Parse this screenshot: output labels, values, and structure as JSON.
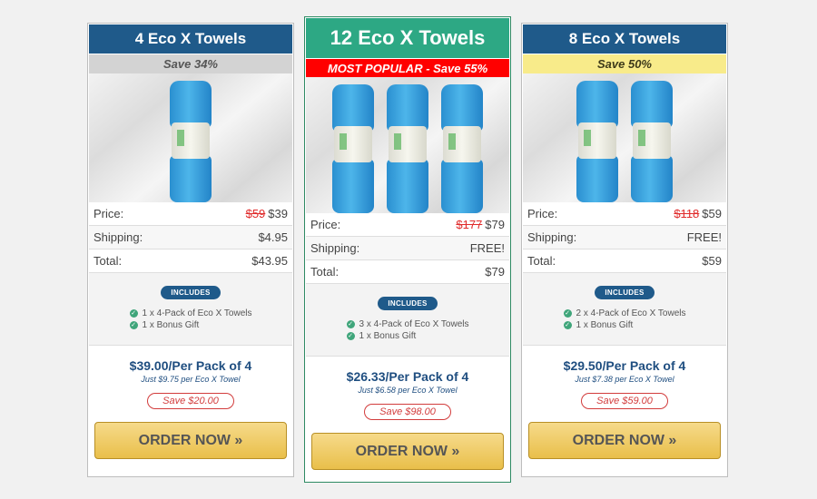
{
  "cards": [
    {
      "title": "4 Eco X Towels",
      "subtitle": "Save 34%",
      "towel_count": 1,
      "price_label": "Price:",
      "old_price": "$59",
      "new_price": "$39",
      "shipping_label": "Shipping:",
      "shipping_value": "$4.95",
      "total_label": "Total:",
      "total_value": "$43.95",
      "includes_label": "INCLUDES",
      "includes": [
        "1 x 4-Pack of Eco X Towels",
        "1 x Bonus Gift"
      ],
      "per_pack": "$39.00/Per Pack of 4",
      "per_towel": "Just $9.75 per Eco X Towel",
      "save_amount": "Save $20.00",
      "order_label": "ORDER NOW »"
    },
    {
      "title": "12 Eco X Towels",
      "subtitle": "MOST POPULAR - Save 55%",
      "towel_count": 3,
      "price_label": "Price:",
      "old_price": "$177",
      "new_price": "$79",
      "shipping_label": "Shipping:",
      "shipping_value": "FREE!",
      "total_label": "Total:",
      "total_value": "$79",
      "includes_label": "INCLUDES",
      "includes": [
        "3 x 4-Pack of Eco X Towels",
        "1 x Bonus Gift"
      ],
      "per_pack": "$26.33/Per Pack of 4",
      "per_towel": "Just $6.58 per Eco X Towel",
      "save_amount": "Save $98.00",
      "order_label": "ORDER NOW »"
    },
    {
      "title": "8 Eco X Towels",
      "subtitle": "Save 50%",
      "towel_count": 2,
      "price_label": "Price:",
      "old_price": "$118",
      "new_price": "$59",
      "shipping_label": "Shipping:",
      "shipping_value": "FREE!",
      "total_label": "Total:",
      "total_value": "$59",
      "includes_label": "INCLUDES",
      "includes": [
        "2 x 4-Pack of Eco X Towels",
        "1 x Bonus Gift"
      ],
      "per_pack": "$29.50/Per Pack of 4",
      "per_towel": "Just $7.38 per Eco X Towel",
      "save_amount": "Save $59.00",
      "order_label": "ORDER NOW »"
    }
  ],
  "icons": {
    "check": "check-circle-icon",
    "arrow": "double-chevron-right"
  },
  "colors": {
    "title_blue": "#1f5a8a",
    "popular_green": "#2da884",
    "popular_red": "#ff0000",
    "save_yellow": "#f8eb8a",
    "button_gold": "#e9bf4a",
    "strike_red": "#e02b2b"
  }
}
